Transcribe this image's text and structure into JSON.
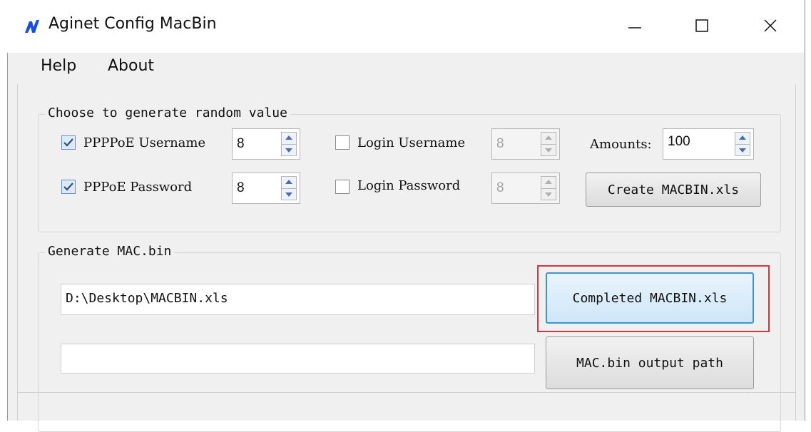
{
  "window": {
    "title": "Aginet Config MacBin",
    "controls": {
      "minimize": "minimize",
      "maximize": "maximize",
      "close": "close"
    }
  },
  "menu": {
    "items": [
      "Help",
      "About"
    ]
  },
  "random_group": {
    "title": "Choose to generate random value",
    "rows": [
      {
        "pppoe_label": "PPPPoE Username",
        "pppoe_checked": true,
        "pppoe_value": "8",
        "login_label": "Login Username",
        "login_checked": false,
        "login_value": "8"
      },
      {
        "pppoe_label": "PPPoE Password",
        "pppoe_checked": true,
        "pppoe_value": "8",
        "login_label": "Login Password",
        "login_checked": false,
        "login_value": "8"
      }
    ],
    "amounts_label": "Amounts:",
    "amounts_value": "100",
    "create_button": "Create MACBIN.xls"
  },
  "mac_group": {
    "title": "Generate MAC.bin",
    "input_path": "D:\\Desktop\\MACBIN.xls",
    "output_path": "",
    "completed_button": "Completed MACBIN.xls",
    "output_button": "MAC.bin output path"
  },
  "colors": {
    "accent": "#3c94d3",
    "highlight": "#d9343f",
    "icon": "#1d4ed8"
  }
}
